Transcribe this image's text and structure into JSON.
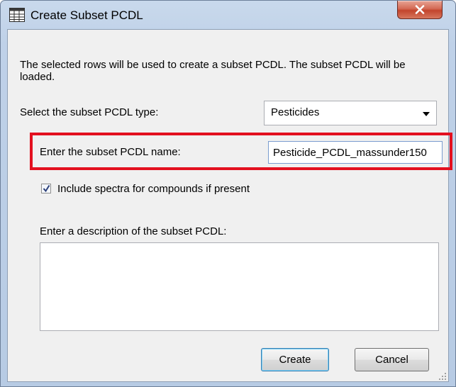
{
  "window": {
    "title": "Create Subset PCDL",
    "icon": "pcdl-app-icon",
    "close_icon": "close-icon"
  },
  "dialog": {
    "intro_text": "The selected rows will be used to create a subset PCDL.  The subset PCDL will be loaded.",
    "type_label": "Select the subset PCDL type:",
    "type_value": "Pesticides",
    "name_label": "Enter the subset PCDL name:",
    "name_value": "Pesticide_PCDL_massunder150",
    "include_spectra_label": "Include spectra for compounds if present",
    "include_spectra_checked": true,
    "description_label": "Enter a description of the subset PCDL:",
    "description_value": "",
    "create_label": "Create",
    "cancel_label": "Cancel"
  },
  "colors": {
    "highlight": "#e3101f",
    "close_button": "#c2452d",
    "client_bg": "#f0f0f0"
  }
}
